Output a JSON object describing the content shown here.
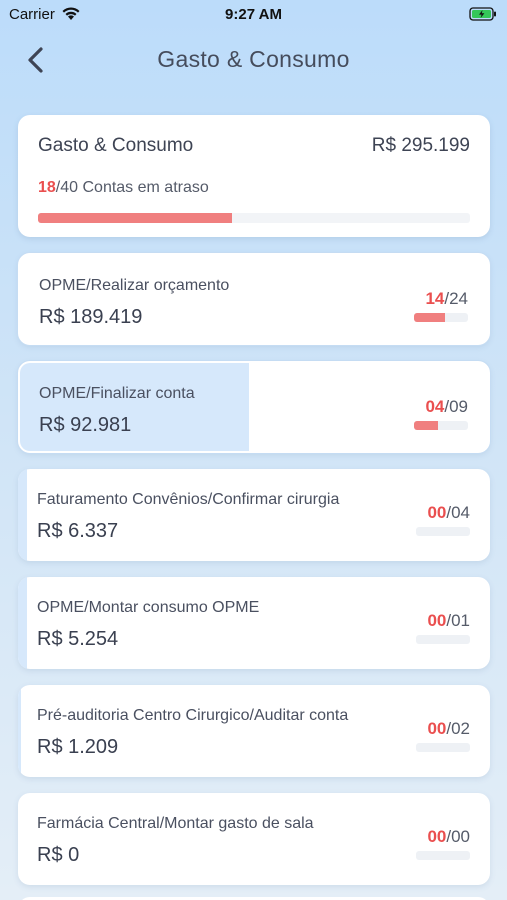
{
  "status_bar": {
    "carrier": "Carrier",
    "time": "9:27 AM"
  },
  "nav": {
    "title": "Gasto & Consumo"
  },
  "summary": {
    "title": "Gasto & Consumo",
    "total": "R$ 295.199",
    "overdue": "18",
    "total_accounts": "/40 Contas em atraso",
    "progress_fraction": 0.45
  },
  "items": [
    {
      "name": "OPME/Realizar orçamento",
      "value": "R$ 189.419",
      "count": "14",
      "total": "/24",
      "fill_fraction": 0.0,
      "bar_fraction": 0.58,
      "active": true
    },
    {
      "name": "OPME/Finalizar conta",
      "value": "R$ 92.981",
      "count": "04",
      "total": "/09",
      "fill_fraction": 0.49,
      "bar_fraction": 0.44,
      "active": true
    },
    {
      "name": "Faturamento Convênios/Confirmar cirurgia",
      "value": "R$ 6.337",
      "count": "00",
      "total": "/04",
      "fill_fraction": 0.02,
      "bar_fraction": 0.0,
      "active": false
    },
    {
      "name": "OPME/Montar consumo OPME",
      "value": "R$ 5.254",
      "count": "00",
      "total": "/01",
      "fill_fraction": 0.02,
      "bar_fraction": 0.0,
      "active": false
    },
    {
      "name": "Pré-auditoria Centro Cirurgico/Auditar conta",
      "value": "R$ 1.209",
      "count": "00",
      "total": "/02",
      "fill_fraction": 0.005,
      "bar_fraction": 0.0,
      "active": false
    },
    {
      "name": "Farmácia Central/Montar gasto de sala",
      "value": "R$ 0",
      "count": "00",
      "total": "/00",
      "fill_fraction": 0.0,
      "bar_fraction": 0.0,
      "active": false
    }
  ],
  "colors": {
    "accent_red": "#ea4f4f",
    "bar_red": "#f07f7f",
    "fill_blue": "#d6e8fb"
  }
}
